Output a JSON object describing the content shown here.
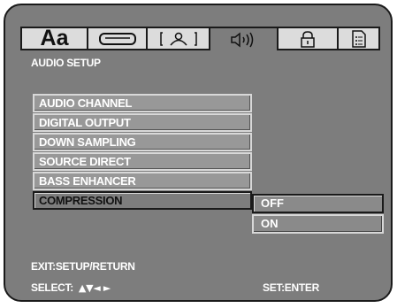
{
  "header": {
    "tabs": [
      {
        "icon": "language-icon",
        "label": "Aa",
        "active": false
      },
      {
        "icon": "screen-icon",
        "label": "",
        "active": false
      },
      {
        "icon": "speaker-layout-icon",
        "label": "",
        "active": false
      },
      {
        "icon": "audio-icon",
        "label": "",
        "active": true
      },
      {
        "icon": "lock-icon",
        "label": "",
        "active": false
      },
      {
        "icon": "misc-settings-icon",
        "label": "",
        "active": false
      }
    ]
  },
  "page": {
    "title": "AUDIO SETUP"
  },
  "menu": {
    "items": [
      {
        "label": "AUDIO CHANNEL",
        "selected": false
      },
      {
        "label": "DIGITAL OUTPUT",
        "selected": false
      },
      {
        "label": "DOWN SAMPLING",
        "selected": false
      },
      {
        "label": "SOURCE DIRECT",
        "selected": false
      },
      {
        "label": "BASS ENHANCER",
        "selected": false
      },
      {
        "label": "COMPRESSION",
        "selected": true
      }
    ]
  },
  "submenu": {
    "options": [
      {
        "label": "OFF",
        "highlighted": true
      },
      {
        "label": "ON",
        "highlighted": false
      }
    ]
  },
  "footer": {
    "exit_hint": "EXIT:SETUP/RETURN",
    "select_hint": "SELECT:",
    "select_arrows": "▲▼◄ ►",
    "set_hint": "SET:ENTER"
  },
  "colors": {
    "panel": "#7d7d7d",
    "tabbar": "#dcdcdc",
    "text": "#ffffff",
    "border": "#1a1a1a"
  }
}
